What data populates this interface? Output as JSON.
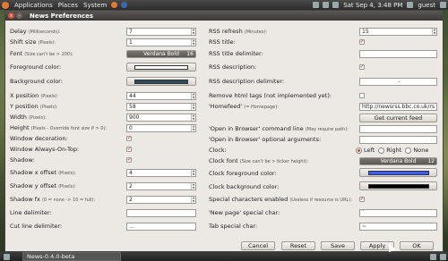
{
  "top_panel": {
    "menus": [
      "Applications",
      "Places",
      "System"
    ],
    "datetime": "Sat Sep 4,  3:48 PM",
    "user": "guest"
  },
  "window": {
    "title": "News Preferences"
  },
  "left": {
    "delay": {
      "label": "Delay",
      "hint": "(Milliseconds):",
      "value": "7"
    },
    "shift": {
      "label": "Shift size",
      "hint": "(Pixels):",
      "value": "1"
    },
    "font": {
      "label": "Font",
      "hint": "(Size can't be > 200):",
      "name": "Verdana Bold",
      "size": "16"
    },
    "fg_color": {
      "label": "Foreground color:",
      "color": "#ffffff"
    },
    "bg_color": {
      "label": "Background color:",
      "color": "#2f4a5c"
    },
    "xpos": {
      "label": "X position",
      "hint": "(Pixels):",
      "value": "44"
    },
    "ypos": {
      "label": "Y position",
      "hint": "(Pixels):",
      "value": "58"
    },
    "width": {
      "label": "Width",
      "hint": "(Pixels):",
      "value": "900"
    },
    "height": {
      "label": "Height",
      "hint": "(Pixels - Override font size if > 0):",
      "value": "0"
    },
    "win_decor": {
      "label": "Window decoration:",
      "checked": true
    },
    "always_top": {
      "label": "Window Always-On-Top:",
      "checked": true
    },
    "shadow": {
      "label": "Shadow:",
      "checked": true
    },
    "shadow_x": {
      "label": "Shadow x offset",
      "hint": "(Pixels):",
      "value": "4"
    },
    "shadow_y": {
      "label": "Shadow y offset",
      "hint": "(Pixels):",
      "value": "2"
    },
    "shadow_fx": {
      "label": "Shadow fx",
      "hint": "(0 = none -> 10 = full):",
      "value": "2"
    },
    "line_delim": {
      "label": "Line delimiter:",
      "value": ""
    },
    "cut_delim": {
      "label": "Cut line delimiter:",
      "value": "..."
    }
  },
  "right": {
    "rss_refresh": {
      "label": "RSS refresh",
      "hint": "(Minutes):",
      "value": "15"
    },
    "rss_title": {
      "label": "RSS title:",
      "checked": true
    },
    "rss_title_delim": {
      "label": "RSS title delimiter:",
      "value": ""
    },
    "rss_desc": {
      "label": "RSS description:",
      "checked": true
    },
    "rss_desc_delim": {
      "label": "RSS description delimiter:",
      "value": "-"
    },
    "remove_html": {
      "label": "Remove html tags (not implemented yet):",
      "checked": false
    },
    "homefeed": {
      "label": "'Homefeed'",
      "hint": "(= Homepage):",
      "value": "http://newsrss.bbc.co.uk/rs"
    },
    "get_feed": {
      "label": "Get current feed"
    },
    "open_cmd": {
      "label": "'Open in Browser' command line",
      "hint": "(May require path):",
      "value": ""
    },
    "open_args": {
      "label": "'Open in Browser' optional arguments:",
      "value": ""
    },
    "clock": {
      "label": "Clock:",
      "options": [
        "Left",
        "Right",
        "None"
      ],
      "selected": "Left"
    },
    "clock_font": {
      "label": "Clock font",
      "hint": "(Size can't be > ticker height):",
      "name": "Verdana Bold",
      "size": "12"
    },
    "clock_fg": {
      "label": "Clock foreground color:",
      "color": "#3a5cff"
    },
    "clock_bg": {
      "label": "Clock background color:",
      "color": "#000000"
    },
    "special_chars": {
      "label": "Special characters enabled",
      "hint": "(Useless if resource is URL):",
      "checked": true
    },
    "new_page": {
      "label": "'New page' special char:",
      "value": "`"
    },
    "tab_char": {
      "label": "Tab special char:",
      "value": "~"
    }
  },
  "buttons": {
    "cancel": "Cancel",
    "reset": "Reset",
    "save": "Save",
    "apply": "Apply",
    "ok": "OK"
  },
  "taskbar": {
    "item": "News-0.4.0-beta"
  }
}
